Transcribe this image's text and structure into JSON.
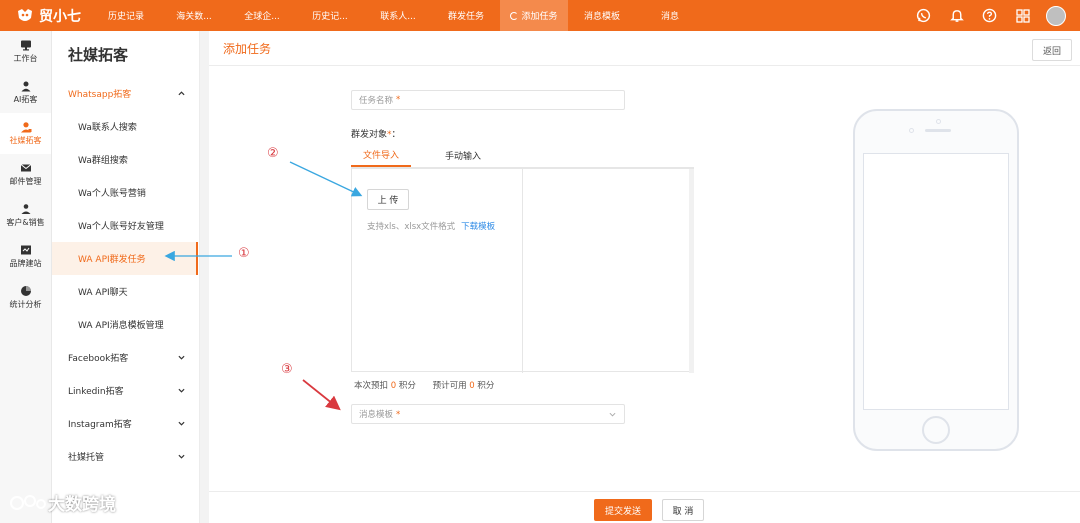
{
  "colors": {
    "brand": "#f06a1b",
    "link": "#2f8be6",
    "annotation_blue": "#3aa7e0",
    "annotation_red": "#d9393f"
  },
  "app": {
    "name": "贸小七"
  },
  "topnav": [
    {
      "label": "历史记录",
      "active": false
    },
    {
      "label": "海关数...",
      "active": false
    },
    {
      "label": "全球企...",
      "active": false
    },
    {
      "label": "历史记...",
      "active": false
    },
    {
      "label": "联系人...",
      "active": false
    },
    {
      "label": "群发任务",
      "active": false
    },
    {
      "label": "添加任务",
      "active": true
    },
    {
      "label": "消息模板",
      "active": false
    },
    {
      "label": "消息",
      "active": false
    }
  ],
  "top_icons": [
    "whatsapp-icon",
    "bell-icon",
    "help-icon",
    "grid-icon",
    "avatar"
  ],
  "rail": [
    {
      "label": "工作台",
      "icon": "monitor-icon"
    },
    {
      "label": "AI拓客",
      "icon": "ai-icon"
    },
    {
      "label": "社媒拓客",
      "icon": "user-icon",
      "active": true
    },
    {
      "label": "邮件管理",
      "icon": "mail-icon"
    },
    {
      "label": "客户&销售",
      "icon": "people-icon"
    },
    {
      "label": "品牌建站",
      "icon": "site-icon"
    },
    {
      "label": "统计分析",
      "icon": "pie-icon"
    }
  ],
  "subnav": {
    "title": "社媒拓客",
    "whatsapp_group": "Whatsapp拓客",
    "items": [
      "Wa联系人搜索",
      "Wa群组搜索",
      "Wa个人账号营销",
      "Wa个人账号好友管理",
      "WA API群发任务",
      "WA API聊天",
      "WA API消息模板管理"
    ],
    "groups": [
      "Facebook拓客",
      "Linkedin拓客",
      "Instagram拓客",
      "社媒托管"
    ]
  },
  "main": {
    "title": "添加任务",
    "back": "返回",
    "task_name_placeholder": "任务名称",
    "req_mark": "*",
    "target_label": "群发对象",
    "target_suffix": "：",
    "tabs": [
      "文件导入",
      "手动输入"
    ],
    "upload_label": "上 传",
    "upload_hint": "支持xls、xlsx文件格式",
    "download_template": "下载模板",
    "points_pre": "本次预扣",
    "points_val": "0",
    "points_unit": "积分",
    "available_pre": "预计可用",
    "available_val": "0",
    "available_unit": "积分",
    "template_placeholder": "消息模板",
    "submit": "提交发送",
    "cancel": "取 消"
  },
  "annotations": [
    "①",
    "②",
    "③"
  ],
  "watermark": "大数跨境"
}
